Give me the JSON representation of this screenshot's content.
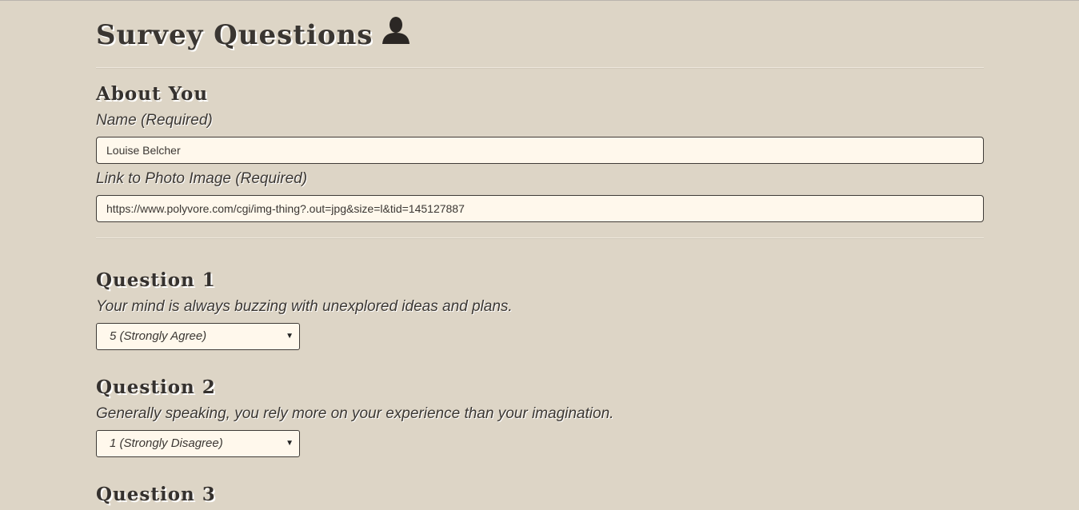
{
  "header": {
    "title": "Survey Questions",
    "icon": "user-silhouette-icon"
  },
  "about": {
    "heading": "About You",
    "name_label": "Name (Required)",
    "name_value": "Louise Belcher",
    "photo_label": "Link to Photo Image (Required)",
    "photo_value": "https://www.polyvore.com/cgi/img-thing?.out=jpg&size=l&tid=145127887"
  },
  "questions": [
    {
      "heading": "Question 1",
      "text": "Your mind is always buzzing with unexplored ideas and plans.",
      "selected": "5 (Strongly Agree)"
    },
    {
      "heading": "Question 2",
      "text": "Generally speaking, you rely more on your experience than your imagination.",
      "selected": "1 (Strongly Disagree)"
    },
    {
      "heading": "Question 3"
    }
  ],
  "colors": {
    "background": "#ddd5c6",
    "input_background": "#fff8ec",
    "text": "#2e2b28"
  }
}
